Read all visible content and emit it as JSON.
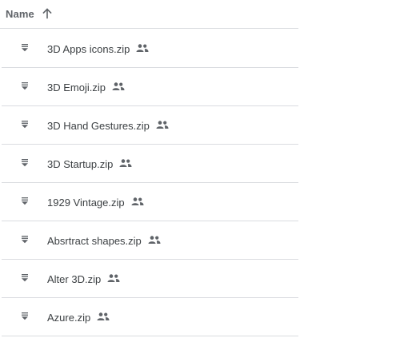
{
  "header": {
    "name_label": "Name",
    "sort_icon": "arrow-upward-icon"
  },
  "files": [
    {
      "name": "3D Apps icons.zip",
      "type_icon": "zip-file-icon",
      "shared_icon": "people-icon"
    },
    {
      "name": "3D Emoji.zip",
      "type_icon": "zip-file-icon",
      "shared_icon": "people-icon"
    },
    {
      "name": "3D Hand Gestures.zip",
      "type_icon": "zip-file-icon",
      "shared_icon": "people-icon"
    },
    {
      "name": "3D Startup.zip",
      "type_icon": "zip-file-icon",
      "shared_icon": "people-icon"
    },
    {
      "name": "1929 Vintage.zip",
      "type_icon": "zip-file-icon",
      "shared_icon": "people-icon"
    },
    {
      "name": "Absrtract shapes.zip",
      "type_icon": "zip-file-icon",
      "shared_icon": "people-icon"
    },
    {
      "name": "Alter 3D.zip",
      "type_icon": "zip-file-icon",
      "shared_icon": "people-icon"
    },
    {
      "name": "Azure.zip",
      "type_icon": "zip-file-icon",
      "shared_icon": "people-icon"
    }
  ],
  "colors": {
    "text": "#3c4043",
    "header_text": "#5f6368",
    "icon": "#5f6368",
    "divider": "#dadce0"
  }
}
